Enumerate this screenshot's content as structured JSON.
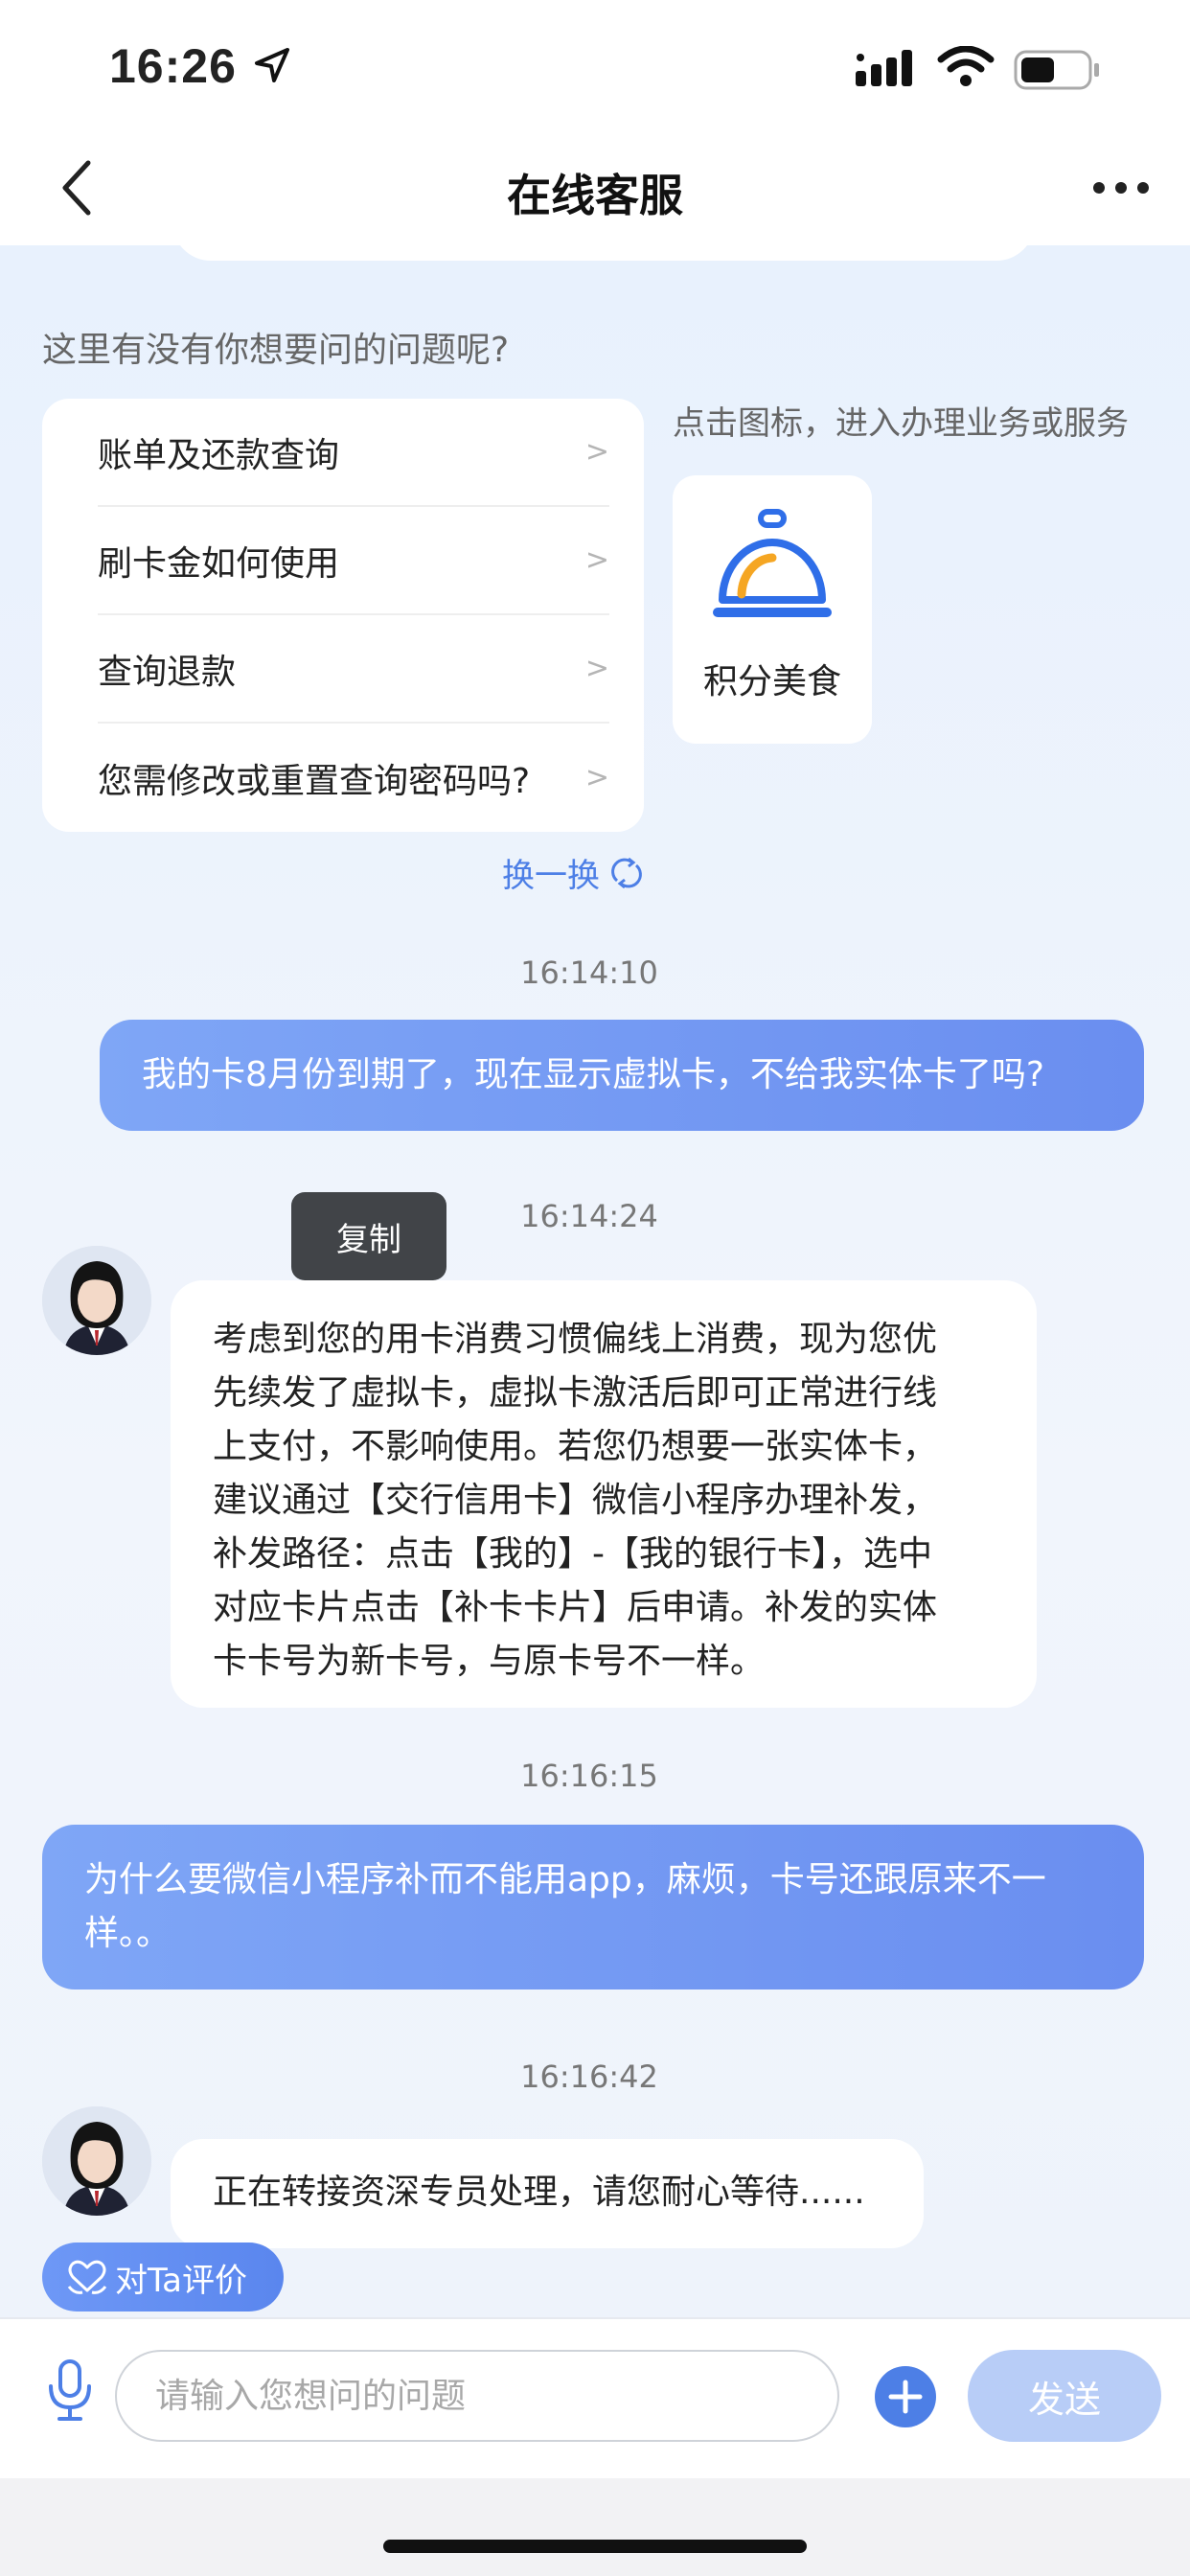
{
  "status_bar": {
    "time": "16:26",
    "icons": [
      "location-arrow-icon",
      "signal-icon",
      "wifi-icon",
      "battery-icon"
    ]
  },
  "nav": {
    "title": "在线客服",
    "back_icon": "chevron-left-icon",
    "more_icon": "more-dots-icon"
  },
  "faq": {
    "heading": "这里有没有你想要问的问题呢?",
    "items": [
      {
        "label": "账单及还款查询",
        "arrow": ">"
      },
      {
        "label": "刷卡金如何使用",
        "arrow": ">"
      },
      {
        "label": "查询退款",
        "arrow": ">"
      },
      {
        "label": "您需修改或重置查询密码吗?",
        "arrow": ">"
      }
    ],
    "refresh_label": "换一换"
  },
  "service": {
    "hint": "点击图标，进入办理业务或服务",
    "label": "积分美食",
    "icon": "service-bell-icon"
  },
  "messages": [
    {
      "time": "16:14:10",
      "from": "user",
      "text": "我的卡8月份到期了，现在显示虚拟卡，不给我实体卡了吗?"
    },
    {
      "time": "16:14:24",
      "from": "agent",
      "lines": [
        "考虑到您的用卡消费习惯偏线上消费，现为您优",
        "先续发了虚拟卡，虚拟卡激活后即可正常进行线",
        "上支付，不影响使用。若您仍想要一张实体卡，",
        "建议通过【交行信用卡】微信小程序办理补发，",
        "补发路径：点击【我的】-【我的银行卡】，选中",
        "对应卡片点击【补卡卡片】后申请。补发的实体",
        "卡卡号为新卡号，与原卡号不一样。"
      ]
    },
    {
      "time": "16:16:15",
      "from": "user",
      "lines": [
        "为什么要微信小程序补而不能用app，麻烦，卡号还跟原来不一",
        "样。。"
      ]
    },
    {
      "time": "16:16:42",
      "from": "agent",
      "text": "正在转接资深专员处理，请您耐心等待......"
    }
  ],
  "copy_tooltip": "复制",
  "rate_button": "对Ta评价",
  "input_bar": {
    "placeholder": "请输入您想问的问题",
    "send_label": "发送",
    "mic_icon": "microphone-icon",
    "plus_icon": "plus-circle-icon"
  },
  "colors": {
    "accent": "#5b87ef",
    "user_bubble": "#7299f3",
    "send_disabled": "#b8cdf7",
    "tooltip": "#414448"
  }
}
